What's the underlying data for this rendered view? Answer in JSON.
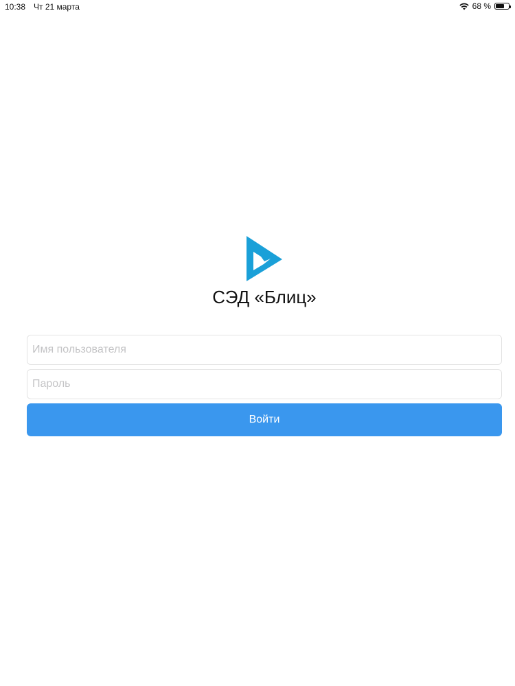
{
  "status_bar": {
    "time": "10:38",
    "date": "Чт 21 марта",
    "battery_label": "68 %",
    "battery_level": 0.68,
    "icons": [
      "wifi-icon",
      "battery-icon"
    ]
  },
  "logo": {
    "icon": "blitz-logo-icon",
    "color": "#1aa0d8"
  },
  "app_title": "СЭД «Блиц»",
  "form": {
    "username_placeholder": "Имя пользователя",
    "username_value": "",
    "password_placeholder": "Пароль",
    "password_value": "",
    "login_label": "Войти"
  },
  "colors": {
    "accent": "#3a97ee",
    "logo": "#1aa0d8",
    "field_border": "#e3e3e3",
    "placeholder": "#c4c4c6"
  }
}
